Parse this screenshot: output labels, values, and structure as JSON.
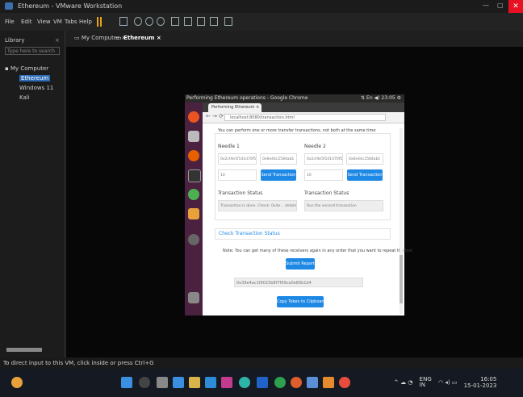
{
  "window": {
    "title": "Ethereum - VMware Workstation"
  },
  "menu": [
    "File",
    "Edit",
    "View",
    "VM",
    "Tabs",
    "Help"
  ],
  "library": {
    "title": "Library",
    "search_placeholder": "Type here to search",
    "items": [
      "My Computer",
      "Ethereum",
      "Windows 11",
      "Kali"
    ]
  },
  "tabs": [
    "My Computer",
    "Ethereum"
  ],
  "guest": {
    "topbar_title": "Performing Ethereum operations - Google Chrome",
    "topbar_right": "⇅ En ◀) 23:05 ⚙",
    "browser_tab": "Performing Ethereum ×",
    "url": "localhost:8080/transaction.html"
  },
  "page": {
    "intro": "You can perform one or more transfer transactions, not both at the same time",
    "needle1": {
      "label": "Needle 1",
      "from": "0x2cf4e5f1d1d70f5",
      "to": "0x6e44c2584ab1",
      "amount": "10",
      "button": "Send Transaction",
      "status_label": "Transaction Status",
      "status_value": "Transaction is done. Check: 0x4e... details"
    },
    "needle2": {
      "label": "Needle 2",
      "from": "0x2cf4e5f1d1d70f5",
      "to": "0x6e44c2584ab1",
      "amount": "10",
      "button": "Send Transaction",
      "status_label": "Transaction Status",
      "status_value": "Run the second transaction"
    },
    "check_link": "Check Transaction Status",
    "note": "Note: You can get many of these receivers again in any order that you want to repeat the test",
    "submit_button": "Submit Report",
    "hash": "0x39e4ac1f9023b8f7f09ca0e80b1b4",
    "copy_button": "Copy Token to Clipboard"
  },
  "statusbar": "To direct input to this VM, click inside or press Ctrl+G",
  "tray": {
    "lang": "ENG\nIN",
    "time": "16:05",
    "date": "15-01-2023"
  }
}
